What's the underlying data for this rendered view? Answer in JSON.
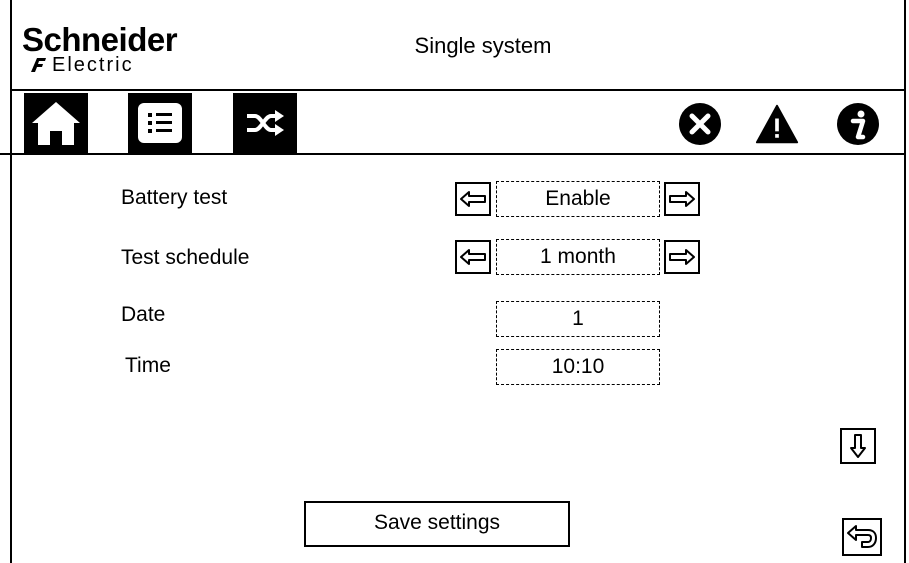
{
  "header": {
    "brand": "Schneider",
    "brand_sub": "Electric",
    "title": "Single system"
  },
  "toolbar": {
    "left_icons": [
      "home-icon",
      "list-icon",
      "shuffle-icon"
    ],
    "right_icons": [
      "error-icon",
      "warning-icon",
      "info-icon"
    ]
  },
  "settings": [
    {
      "label": "Battery test",
      "value": "Enable"
    },
    {
      "label": "Test schedule",
      "value": "1 month"
    },
    {
      "label": "Date",
      "value": "1"
    },
    {
      "label": "Time",
      "value": "10:10"
    }
  ],
  "actions": {
    "save_label": "Save settings"
  }
}
